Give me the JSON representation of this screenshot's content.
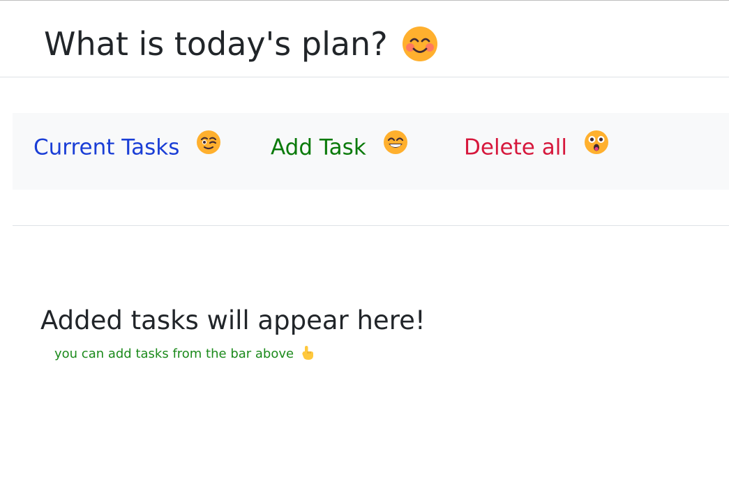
{
  "header": {
    "title": "What is today's plan?",
    "title_icon": "smiling-face-with-smiling-eyes-icon"
  },
  "nav": {
    "items": [
      {
        "label": "Current Tasks",
        "icon": "winking-face-icon",
        "color": "#1a3ed6"
      },
      {
        "label": "Add Task",
        "icon": "beaming-face-icon",
        "color": "#0a7a0a"
      },
      {
        "label": "Delete all",
        "icon": "astonished-face-icon",
        "color": "#d6183c"
      }
    ]
  },
  "empty_state": {
    "title": "Added tasks will appear here!",
    "hint": "you can add tasks from the bar above",
    "hint_icon": "pointing-up-hand-icon",
    "hint_color": "#1b8a1b"
  }
}
